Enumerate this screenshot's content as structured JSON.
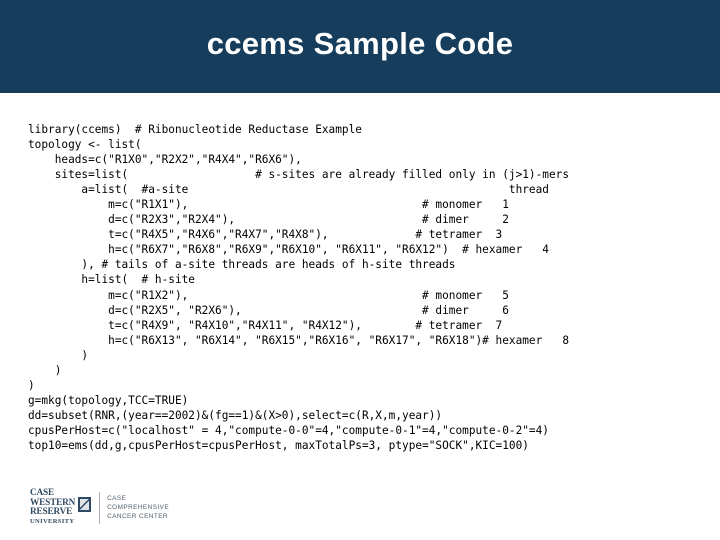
{
  "slide": {
    "title": "ccems Sample Code",
    "header_color": "#163e5c",
    "background_color": "#ffffff",
    "text_color": "#000000"
  },
  "code": {
    "language": "R",
    "lines": [
      "library(ccems)  # Ribonucleotide Reductase Example",
      "topology <- list(",
      "    heads=c(\"R1X0\",\"R2X2\",\"R4X4\",\"R6X6\"),",
      "    sites=list(                   # s-sites are already filled only in (j>1)-mers",
      "        a=list(  #a-site                                                thread",
      "            m=c(\"R1X1\"),                                   # monomer   1",
      "            d=c(\"R2X3\",\"R2X4\"),                            # dimer     2",
      "            t=c(\"R4X5\",\"R4X6\",\"R4X7\",\"R4X8\"),             # tetramer  3",
      "            h=c(\"R6X7\",\"R6X8\",\"R6X9\",\"R6X10\", \"R6X11\", \"R6X12\")  # hexamer   4",
      "        ), # tails of a-site threads are heads of h-site threads",
      "        h=list(  # h-site",
      "            m=c(\"R1X2\"),                                   # monomer   5",
      "            d=c(\"R2X5\", \"R2X6\"),                           # dimer     6",
      "            t=c(\"R4X9\", \"R4X10\",\"R4X11\", \"R4X12\"),        # tetramer  7",
      "            h=c(\"R6X13\", \"R6X14\", \"R6X15\",\"R6X16\", \"R6X17\", \"R6X18\")# hexamer   8",
      "        )",
      "    )",
      ")",
      "g=mkg(topology,TCC=TRUE)",
      "dd=subset(RNR,(year==2002)&(fg==1)&(X>0),select=c(R,X,m,year))",
      "cpusPerHost=c(\"localhost\" = 4,\"compute-0-0\"=4,\"compute-0-1\"=4,\"compute-0-2\"=4)",
      "top10=ems(dd,g,cpusPerHost=cpusPerHost, maxTotalPs=3, ptype=\"SOCK\",KIC=100)"
    ]
  },
  "footer": {
    "university": {
      "line1": "CASE",
      "line2": "WESTERN",
      "line3": "RESERVE",
      "line4": "UNIVERSITY"
    },
    "center": {
      "line1": "CASE",
      "line2": "COMPREHENSIVE",
      "line3": "CANCER CENTER"
    }
  }
}
